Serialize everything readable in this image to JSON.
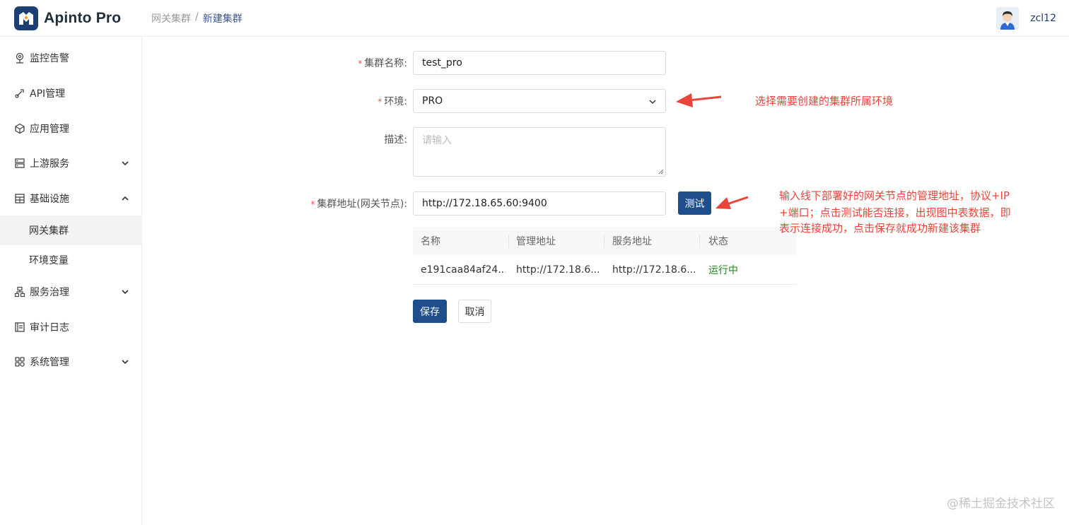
{
  "app": {
    "name": "Apinto Pro"
  },
  "breadcrumb": {
    "parent": "网关集群",
    "separator": "/",
    "current": "新建集群"
  },
  "user": {
    "name": "zcl12"
  },
  "sidebar": {
    "items": [
      {
        "label": "监控告警",
        "icon": "monitor-pin-icon"
      },
      {
        "label": "API管理",
        "icon": "api-rocket-icon"
      },
      {
        "label": "应用管理",
        "icon": "app-cube-icon"
      },
      {
        "label": "上游服务",
        "icon": "upstream-server-icon",
        "expandable": true
      },
      {
        "label": "基础设施",
        "icon": "infrastructure-icon",
        "expandable": true,
        "expanded": true
      },
      {
        "label": "服务治理",
        "icon": "governance-icon",
        "expandable": true
      },
      {
        "label": "审计日志",
        "icon": "audit-log-icon"
      },
      {
        "label": "系统管理",
        "icon": "system-grid-icon",
        "expandable": true
      }
    ],
    "subitems": [
      {
        "label": "网关集群",
        "active": true
      },
      {
        "label": "环境变量",
        "active": false
      }
    ]
  },
  "form": {
    "name_label": "集群名称:",
    "name_value": "test_pro",
    "env_label": "环境:",
    "env_value": "PRO",
    "desc_label": "描述:",
    "desc_placeholder": "请输入",
    "addr_label": "集群地址(网关节点):",
    "addr_value": "http://172.18.65.60:9400",
    "test_button": "测试",
    "save_button": "保存",
    "cancel_button": "取消"
  },
  "node_table": {
    "columns": [
      "名称",
      "管理地址",
      "服务地址",
      "状态"
    ],
    "rows": [
      {
        "name": "e191caa84af24...",
        "admin_addr": "http://172.18.6...",
        "service_addr": "http://172.18.6...",
        "status": "运行中"
      }
    ]
  },
  "annotations": {
    "env_note": "选择需要创建的集群所属环境",
    "addr_note_line1": "输入线下部署好的网关节点的管理地址，协议+IP",
    "addr_note_line2": "+端口；点击测试能否连接，出现图中表数据，即",
    "addr_note_line3": "表示连接成功，点击保存就成功新建该集群"
  },
  "watermark": "@稀土掘金技术社区",
  "colors": {
    "primary": "#1e4e8c",
    "annotation": "#e8443a",
    "status_running": "#1a8a1a",
    "required": "#e5554f"
  }
}
